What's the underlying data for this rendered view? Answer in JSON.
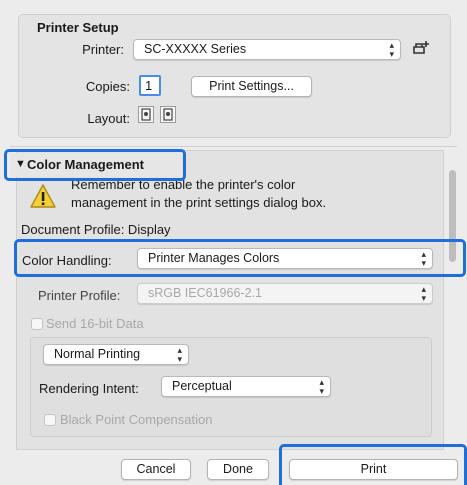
{
  "printer_setup": {
    "title": "Printer Setup",
    "printer_label": "Printer:",
    "printer_value": "SC-XXXXX Series",
    "copies_label": "Copies:",
    "copies_value": "1",
    "print_settings_label": "Print Settings...",
    "layout_label": "Layout:"
  },
  "color_management": {
    "section_title": "Color Management",
    "warning_text": "Remember to enable the printer's color management in the print settings dialog box.",
    "document_profile": "Document Profile: Display",
    "color_handling_label": "Color Handling:",
    "color_handling_value": "Printer Manages Colors",
    "printer_profile_label": "Printer Profile:",
    "printer_profile_value": "sRGB IEC61966-2.1",
    "send_16bit_label": "Send 16-bit Data",
    "printing_mode_value": "Normal Printing",
    "rendering_intent_label": "Rendering Intent:",
    "rendering_intent_value": "Perceptual",
    "black_point_label": "Black Point Compensation"
  },
  "footer": {
    "cancel_label": "Cancel",
    "done_label": "Done",
    "print_label": "Print"
  },
  "colors": {
    "highlight": "#1e6fd9",
    "background": "#ececec"
  }
}
